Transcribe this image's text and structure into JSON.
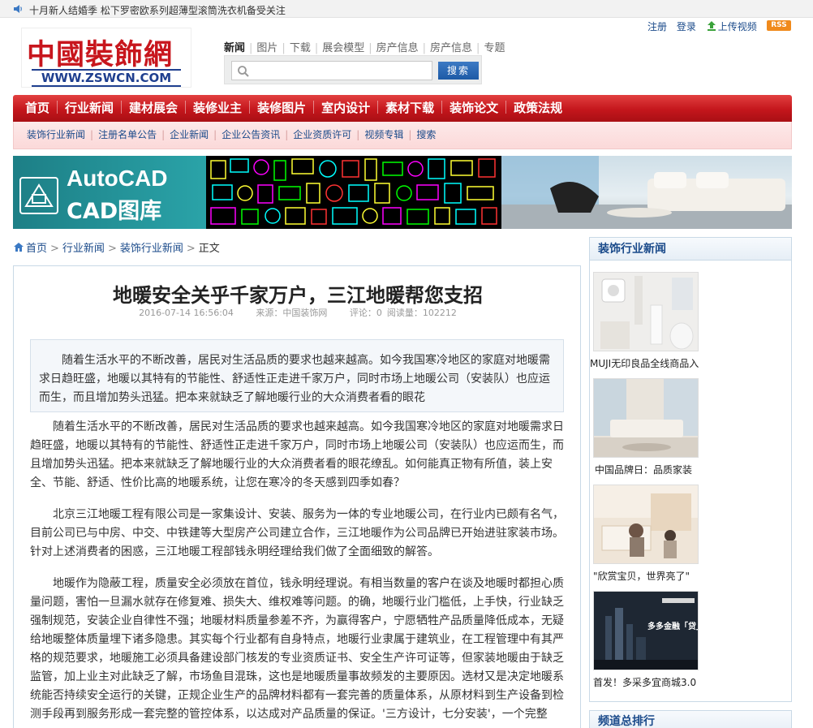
{
  "topbar": {
    "notice": "十月新人结婚季 松下罗密欧系列超薄型滚筒洗衣机备受关注"
  },
  "logo": {
    "cn": "中國裝飾網",
    "en": "WWW.ZSWCN.COM"
  },
  "search": {
    "tabs": [
      "新闻",
      "图片",
      "下载",
      "展会模型",
      "房产信息",
      "房产信息",
      "专题"
    ],
    "placeholder": "",
    "button": "搜索"
  },
  "user_links": {
    "register": "注册",
    "login": "登录",
    "upload": "上传视频",
    "rss": "RSS"
  },
  "main_nav": [
    "首页",
    "行业新闻",
    "建材展会",
    "装修业主",
    "装修图片",
    "室内设计",
    "素材下载",
    "装饰论文",
    "政策法规"
  ],
  "sub_nav": [
    "装饰行业新闻",
    "注册名单公告",
    "企业新闻",
    "企业公告资讯",
    "企业资质许可",
    "视频专辑",
    "搜索"
  ],
  "banner": {
    "title1": "AutoCAD",
    "title2": "CAD图库"
  },
  "breadcrumb": {
    "home": "首页",
    "level1": "行业新闻",
    "level2": "装饰行业新闻",
    "current": "正文"
  },
  "article": {
    "title": "地暖安全关乎千家万户，三江地暖帮您支招",
    "date": "2016-07-14 16:56:04",
    "source": "来源：中国装饰网",
    "comments": "评论：0",
    "reads": "阅读量：102212",
    "summary": "随着生活水平的不断改善，居民对生活品质的要求也越来越高。如今我国寒冷地区的家庭对地暖需求日趋旺盛，地暖以其特有的节能性、舒适性正走进千家万户，同时市场上地暖公司（安装队）也应运而生，而且增加势头迅猛。把本来就缺乏了解地暖行业的大众消费者看的眼花",
    "paragraphs": [
      "随着生活水平的不断改善，居民对生活品质的要求也越来越高。如今我国寒冷地区的家庭对地暖需求日趋旺盛，地暖以其特有的节能性、舒适性正走进千家万户，同时市场上地暖公司（安装队）也应运而生，而且增加势头迅猛。把本来就缺乏了解地暖行业的大众消费者看的眼花缭乱。如何能真正物有所值，装上安全、节能、舒适、性价比高的地暖系统，让您在寒冷的冬天感到四季如春？",
      "北京三江地暖工程有限公司是一家集设计、安装、服务为一体的专业地暖公司，在行业内已颇有名气，目前公司已与中房、中交、中铁建等大型房产公司建立合作，三江地暖作为公司品牌已开始进驻家装市场。针对上述消费者的困惑，三江地暖工程部钱永明经理给我们做了全面细致的解答。",
      "地暖作为隐蔽工程，质量安全必须放在首位，钱永明经理说。有相当数量的客户在谈及地暖时都担心质量问题，害怕一旦漏水就存在修复难、损失大、维权难等问题。的确，地暖行业门槛低，上手快，行业缺乏强制规范，安装企业自律性不强；地暖材料质量参差不齐，为赢得客户，宁愿牺牲产品质量降低成本，无疑给地暖整体质量埋下诸多隐患。其实每个行业都有自身特点，地暖行业隶属于建筑业，在工程管理中有其严格的规范要求，地暖施工必须具备建设部门核发的专业资质证书、安全生产许可证等，但家装地暖由于缺乏监管，加上业主对此缺乏了解，市场鱼目混珠，这也是地暖质量事故频发的主要原因。选材又是决定地暖系统能否持续安全运行的关键，正规企业生产的品牌材料都有一套完善的质量体系，从原材料到生产设备到检测手段再到服务形成一套完整的管控体系，以达成对产品质量的保证。'三方设计，七分安装'，一个完整"
    ]
  },
  "sidebar": {
    "title": "装饰行业新闻",
    "items": [
      {
        "caption": "MUJI无印良品全线商品入"
      },
      {
        "caption": "中国品牌日：品质家装"
      },
      {
        "caption": "\"欣赏宝贝，世界亮了\""
      },
      {
        "caption": "首发！多采多宜商城3.0"
      }
    ],
    "thumb4_text": "多多金融「贷」",
    "rank_title": "频道总排行"
  }
}
